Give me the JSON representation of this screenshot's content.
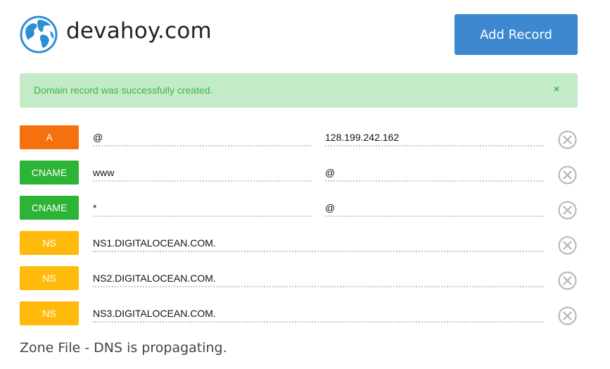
{
  "header": {
    "domain": "devahoy.com",
    "add_record_label": "Add Record",
    "icon": "globe-icon"
  },
  "alert": {
    "message": "Domain record was successfully created.",
    "close_glyph": "×"
  },
  "records": [
    {
      "type": "A",
      "name": "@",
      "value": "128.199.242.162"
    },
    {
      "type": "CNAME",
      "name": "www",
      "value": "@"
    },
    {
      "type": "CNAME",
      "name": "*",
      "value": "@"
    },
    {
      "type": "NS",
      "name": "NS1.DIGITALOCEAN.COM.",
      "value": ""
    },
    {
      "type": "NS",
      "name": "NS2.DIGITALOCEAN.COM.",
      "value": ""
    },
    {
      "type": "NS",
      "name": "NS3.DIGITALOCEAN.COM.",
      "value": ""
    }
  ],
  "footer": {
    "status": "Zone File - DNS is propagating."
  },
  "colors": {
    "primary": "#3d88cf",
    "alert_bg": "#c4ebc7",
    "alert_text": "#3cb54a",
    "type_a": "#f5700e",
    "type_cname": "#2db336",
    "type_ns": "#ffba0c"
  }
}
